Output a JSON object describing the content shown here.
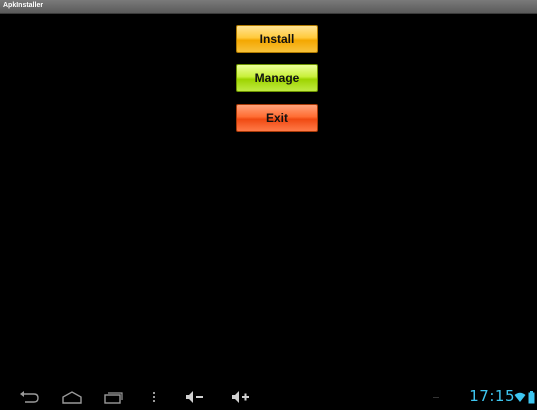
{
  "window": {
    "title": "ApkInstaller"
  },
  "buttons": {
    "install": "Install",
    "manage": "Manage",
    "exit": "Exit"
  },
  "status_bar": {
    "time": "17:15",
    "icons": [
      "back-icon",
      "home-icon",
      "recent-apps-icon",
      "menu-icon",
      "volume-down-icon",
      "volume-up-icon",
      "wifi-icon",
      "battery-icon"
    ]
  },
  "colors": {
    "install": "#f4a700",
    "manage": "#9ed400",
    "exit": "#f04a12",
    "clock": "#3ec6f0"
  }
}
